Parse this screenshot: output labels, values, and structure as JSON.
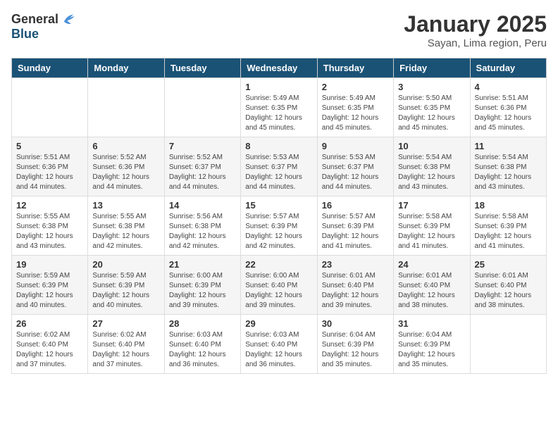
{
  "header": {
    "logo_general": "General",
    "logo_blue": "Blue",
    "month_title": "January 2025",
    "subtitle": "Sayan, Lima region, Peru"
  },
  "days_of_week": [
    "Sunday",
    "Monday",
    "Tuesday",
    "Wednesday",
    "Thursday",
    "Friday",
    "Saturday"
  ],
  "weeks": [
    [
      {
        "day": "",
        "info": ""
      },
      {
        "day": "",
        "info": ""
      },
      {
        "day": "",
        "info": ""
      },
      {
        "day": "1",
        "info": "Sunrise: 5:49 AM\nSunset: 6:35 PM\nDaylight: 12 hours\nand 45 minutes."
      },
      {
        "day": "2",
        "info": "Sunrise: 5:49 AM\nSunset: 6:35 PM\nDaylight: 12 hours\nand 45 minutes."
      },
      {
        "day": "3",
        "info": "Sunrise: 5:50 AM\nSunset: 6:35 PM\nDaylight: 12 hours\nand 45 minutes."
      },
      {
        "day": "4",
        "info": "Sunrise: 5:51 AM\nSunset: 6:36 PM\nDaylight: 12 hours\nand 45 minutes."
      }
    ],
    [
      {
        "day": "5",
        "info": "Sunrise: 5:51 AM\nSunset: 6:36 PM\nDaylight: 12 hours\nand 44 minutes."
      },
      {
        "day": "6",
        "info": "Sunrise: 5:52 AM\nSunset: 6:36 PM\nDaylight: 12 hours\nand 44 minutes."
      },
      {
        "day": "7",
        "info": "Sunrise: 5:52 AM\nSunset: 6:37 PM\nDaylight: 12 hours\nand 44 minutes."
      },
      {
        "day": "8",
        "info": "Sunrise: 5:53 AM\nSunset: 6:37 PM\nDaylight: 12 hours\nand 44 minutes."
      },
      {
        "day": "9",
        "info": "Sunrise: 5:53 AM\nSunset: 6:37 PM\nDaylight: 12 hours\nand 44 minutes."
      },
      {
        "day": "10",
        "info": "Sunrise: 5:54 AM\nSunset: 6:38 PM\nDaylight: 12 hours\nand 43 minutes."
      },
      {
        "day": "11",
        "info": "Sunrise: 5:54 AM\nSunset: 6:38 PM\nDaylight: 12 hours\nand 43 minutes."
      }
    ],
    [
      {
        "day": "12",
        "info": "Sunrise: 5:55 AM\nSunset: 6:38 PM\nDaylight: 12 hours\nand 43 minutes."
      },
      {
        "day": "13",
        "info": "Sunrise: 5:55 AM\nSunset: 6:38 PM\nDaylight: 12 hours\nand 42 minutes."
      },
      {
        "day": "14",
        "info": "Sunrise: 5:56 AM\nSunset: 6:38 PM\nDaylight: 12 hours\nand 42 minutes."
      },
      {
        "day": "15",
        "info": "Sunrise: 5:57 AM\nSunset: 6:39 PM\nDaylight: 12 hours\nand 42 minutes."
      },
      {
        "day": "16",
        "info": "Sunrise: 5:57 AM\nSunset: 6:39 PM\nDaylight: 12 hours\nand 41 minutes."
      },
      {
        "day": "17",
        "info": "Sunrise: 5:58 AM\nSunset: 6:39 PM\nDaylight: 12 hours\nand 41 minutes."
      },
      {
        "day": "18",
        "info": "Sunrise: 5:58 AM\nSunset: 6:39 PM\nDaylight: 12 hours\nand 41 minutes."
      }
    ],
    [
      {
        "day": "19",
        "info": "Sunrise: 5:59 AM\nSunset: 6:39 PM\nDaylight: 12 hours\nand 40 minutes."
      },
      {
        "day": "20",
        "info": "Sunrise: 5:59 AM\nSunset: 6:39 PM\nDaylight: 12 hours\nand 40 minutes."
      },
      {
        "day": "21",
        "info": "Sunrise: 6:00 AM\nSunset: 6:39 PM\nDaylight: 12 hours\nand 39 minutes."
      },
      {
        "day": "22",
        "info": "Sunrise: 6:00 AM\nSunset: 6:40 PM\nDaylight: 12 hours\nand 39 minutes."
      },
      {
        "day": "23",
        "info": "Sunrise: 6:01 AM\nSunset: 6:40 PM\nDaylight: 12 hours\nand 39 minutes."
      },
      {
        "day": "24",
        "info": "Sunrise: 6:01 AM\nSunset: 6:40 PM\nDaylight: 12 hours\nand 38 minutes."
      },
      {
        "day": "25",
        "info": "Sunrise: 6:01 AM\nSunset: 6:40 PM\nDaylight: 12 hours\nand 38 minutes."
      }
    ],
    [
      {
        "day": "26",
        "info": "Sunrise: 6:02 AM\nSunset: 6:40 PM\nDaylight: 12 hours\nand 37 minutes."
      },
      {
        "day": "27",
        "info": "Sunrise: 6:02 AM\nSunset: 6:40 PM\nDaylight: 12 hours\nand 37 minutes."
      },
      {
        "day": "28",
        "info": "Sunrise: 6:03 AM\nSunset: 6:40 PM\nDaylight: 12 hours\nand 36 minutes."
      },
      {
        "day": "29",
        "info": "Sunrise: 6:03 AM\nSunset: 6:40 PM\nDaylight: 12 hours\nand 36 minutes."
      },
      {
        "day": "30",
        "info": "Sunrise: 6:04 AM\nSunset: 6:39 PM\nDaylight: 12 hours\nand 35 minutes."
      },
      {
        "day": "31",
        "info": "Sunrise: 6:04 AM\nSunset: 6:39 PM\nDaylight: 12 hours\nand 35 minutes."
      },
      {
        "day": "",
        "info": ""
      }
    ]
  ]
}
